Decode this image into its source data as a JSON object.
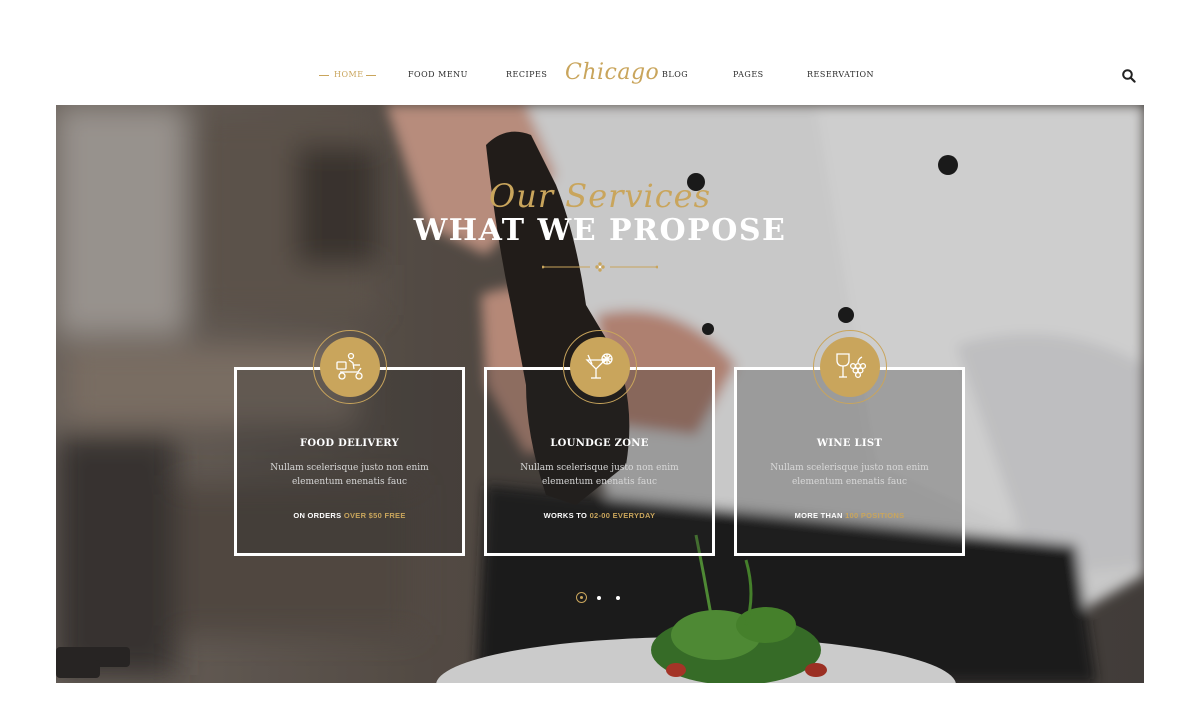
{
  "nav": {
    "items": [
      {
        "label": "HOME",
        "active": true
      },
      {
        "label": "FOOD MENU",
        "active": false
      },
      {
        "label": "RECIPES",
        "active": false
      },
      {
        "label": "BLOG",
        "active": false
      },
      {
        "label": "PAGES",
        "active": false
      },
      {
        "label": "RESERVATION",
        "active": false
      }
    ],
    "logo": "Chicago",
    "search_icon": "search-icon"
  },
  "hero": {
    "script_title": "Our Services",
    "title": "WHAT WE PROPOSE",
    "divider_icon": "flower-ornament-icon"
  },
  "services": [
    {
      "icon": "delivery-scooter-icon",
      "title": "FOOD DELIVERY",
      "description": "Nullam scelerisque justo non enim elementum enenatis fauc",
      "footer_prefix": "ON ORDERS ",
      "footer_highlight": "OVER $50 FREE"
    },
    {
      "icon": "cocktail-glass-icon",
      "title": "LOUNDGE ZONE",
      "description": "Nullam scelerisque justo non enim elementum enenatis fauc",
      "footer_prefix": "WORKS TO ",
      "footer_highlight": "02-00 EVERYDAY"
    },
    {
      "icon": "wine-grapes-icon",
      "title": "WINE LIST",
      "description": "Nullam scelerisque justo non enim elementum enenatis fauc",
      "footer_prefix": "MORE THAN ",
      "footer_highlight": "100 POSITIONS"
    }
  ],
  "pagination": {
    "count": 3,
    "active": 1
  },
  "colors": {
    "accent": "#c9a55c",
    "text_dark": "#2b2b2b",
    "white": "#ffffff"
  }
}
